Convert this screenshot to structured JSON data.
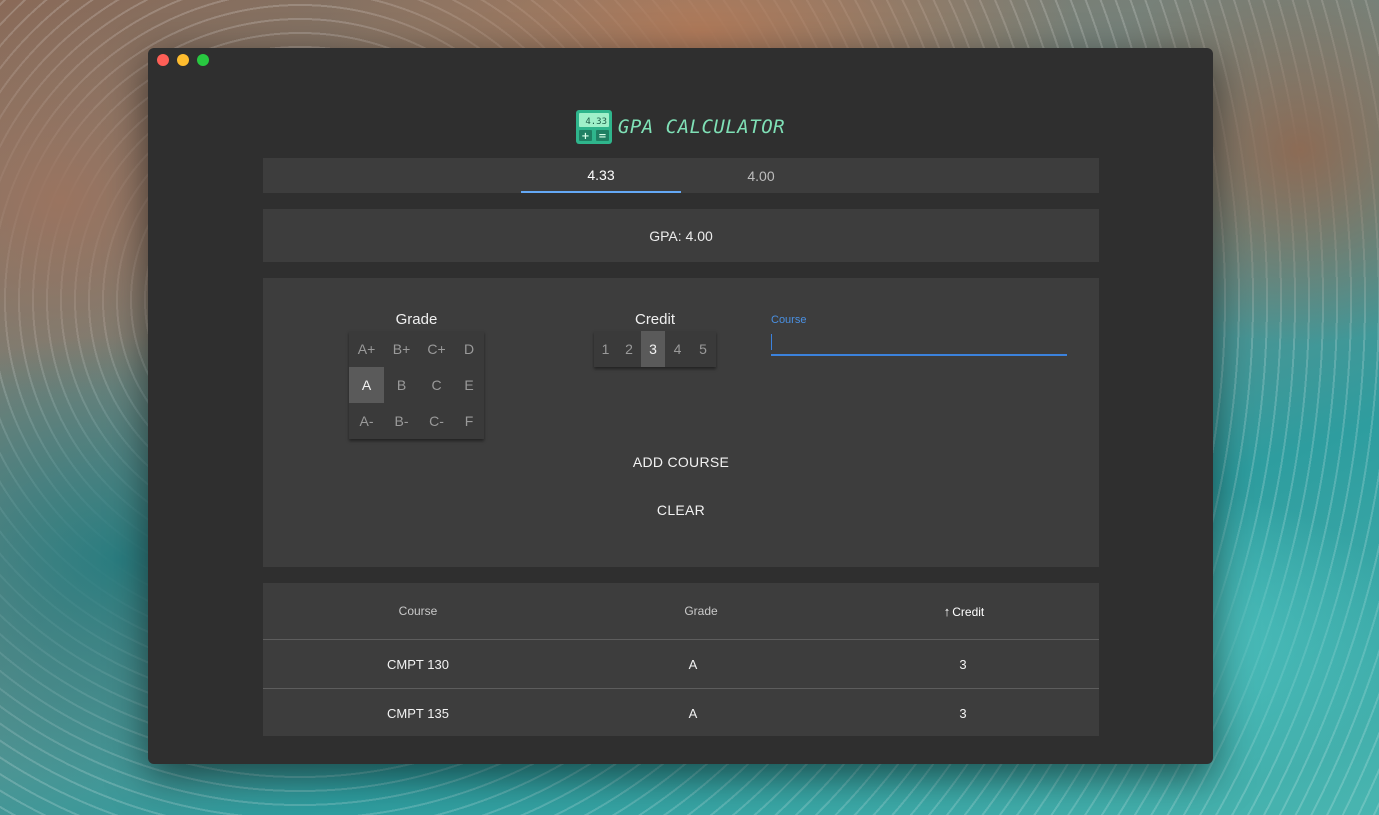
{
  "window": {
    "traffic_lights": [
      "close",
      "minimize",
      "zoom"
    ]
  },
  "brand": {
    "title": "GPA CALCULATOR",
    "icon_display": "4.33",
    "icon_name": "calculator-icon"
  },
  "scale_tabs": [
    {
      "label": "4.33",
      "active": true
    },
    {
      "label": "4.00",
      "active": false
    }
  ],
  "gpa": {
    "text": "GPA: 4.00"
  },
  "form": {
    "grade_label": "Grade",
    "grades": [
      [
        "A+",
        "B+",
        "C+",
        "D"
      ],
      [
        "A",
        "B",
        "C",
        "E"
      ],
      [
        "A-",
        "B-",
        "C-",
        "F"
      ]
    ],
    "selected_grade": "A",
    "credit_label": "Credit",
    "credits": [
      "1",
      "2",
      "3",
      "4",
      "5"
    ],
    "selected_credit": "3",
    "course_label": "Course",
    "course_value": "",
    "add_button": "ADD COURSE",
    "clear_button": "CLEAR"
  },
  "table": {
    "headers": [
      "Course",
      "Grade",
      "Credit"
    ],
    "sort_icon": "arrow-up-icon",
    "rows": [
      {
        "course": "CMPT 130",
        "grade": "A",
        "credit": "3"
      },
      {
        "course": "CMPT 135",
        "grade": "A",
        "credit": "3"
      }
    ]
  },
  "colors": {
    "accent": "#64a8f5",
    "input_accent": "#3b82dd",
    "brand_text": "#7fe0b6",
    "window_bg": "#2f2f2f",
    "panel_bg": "#3d3d3d"
  }
}
